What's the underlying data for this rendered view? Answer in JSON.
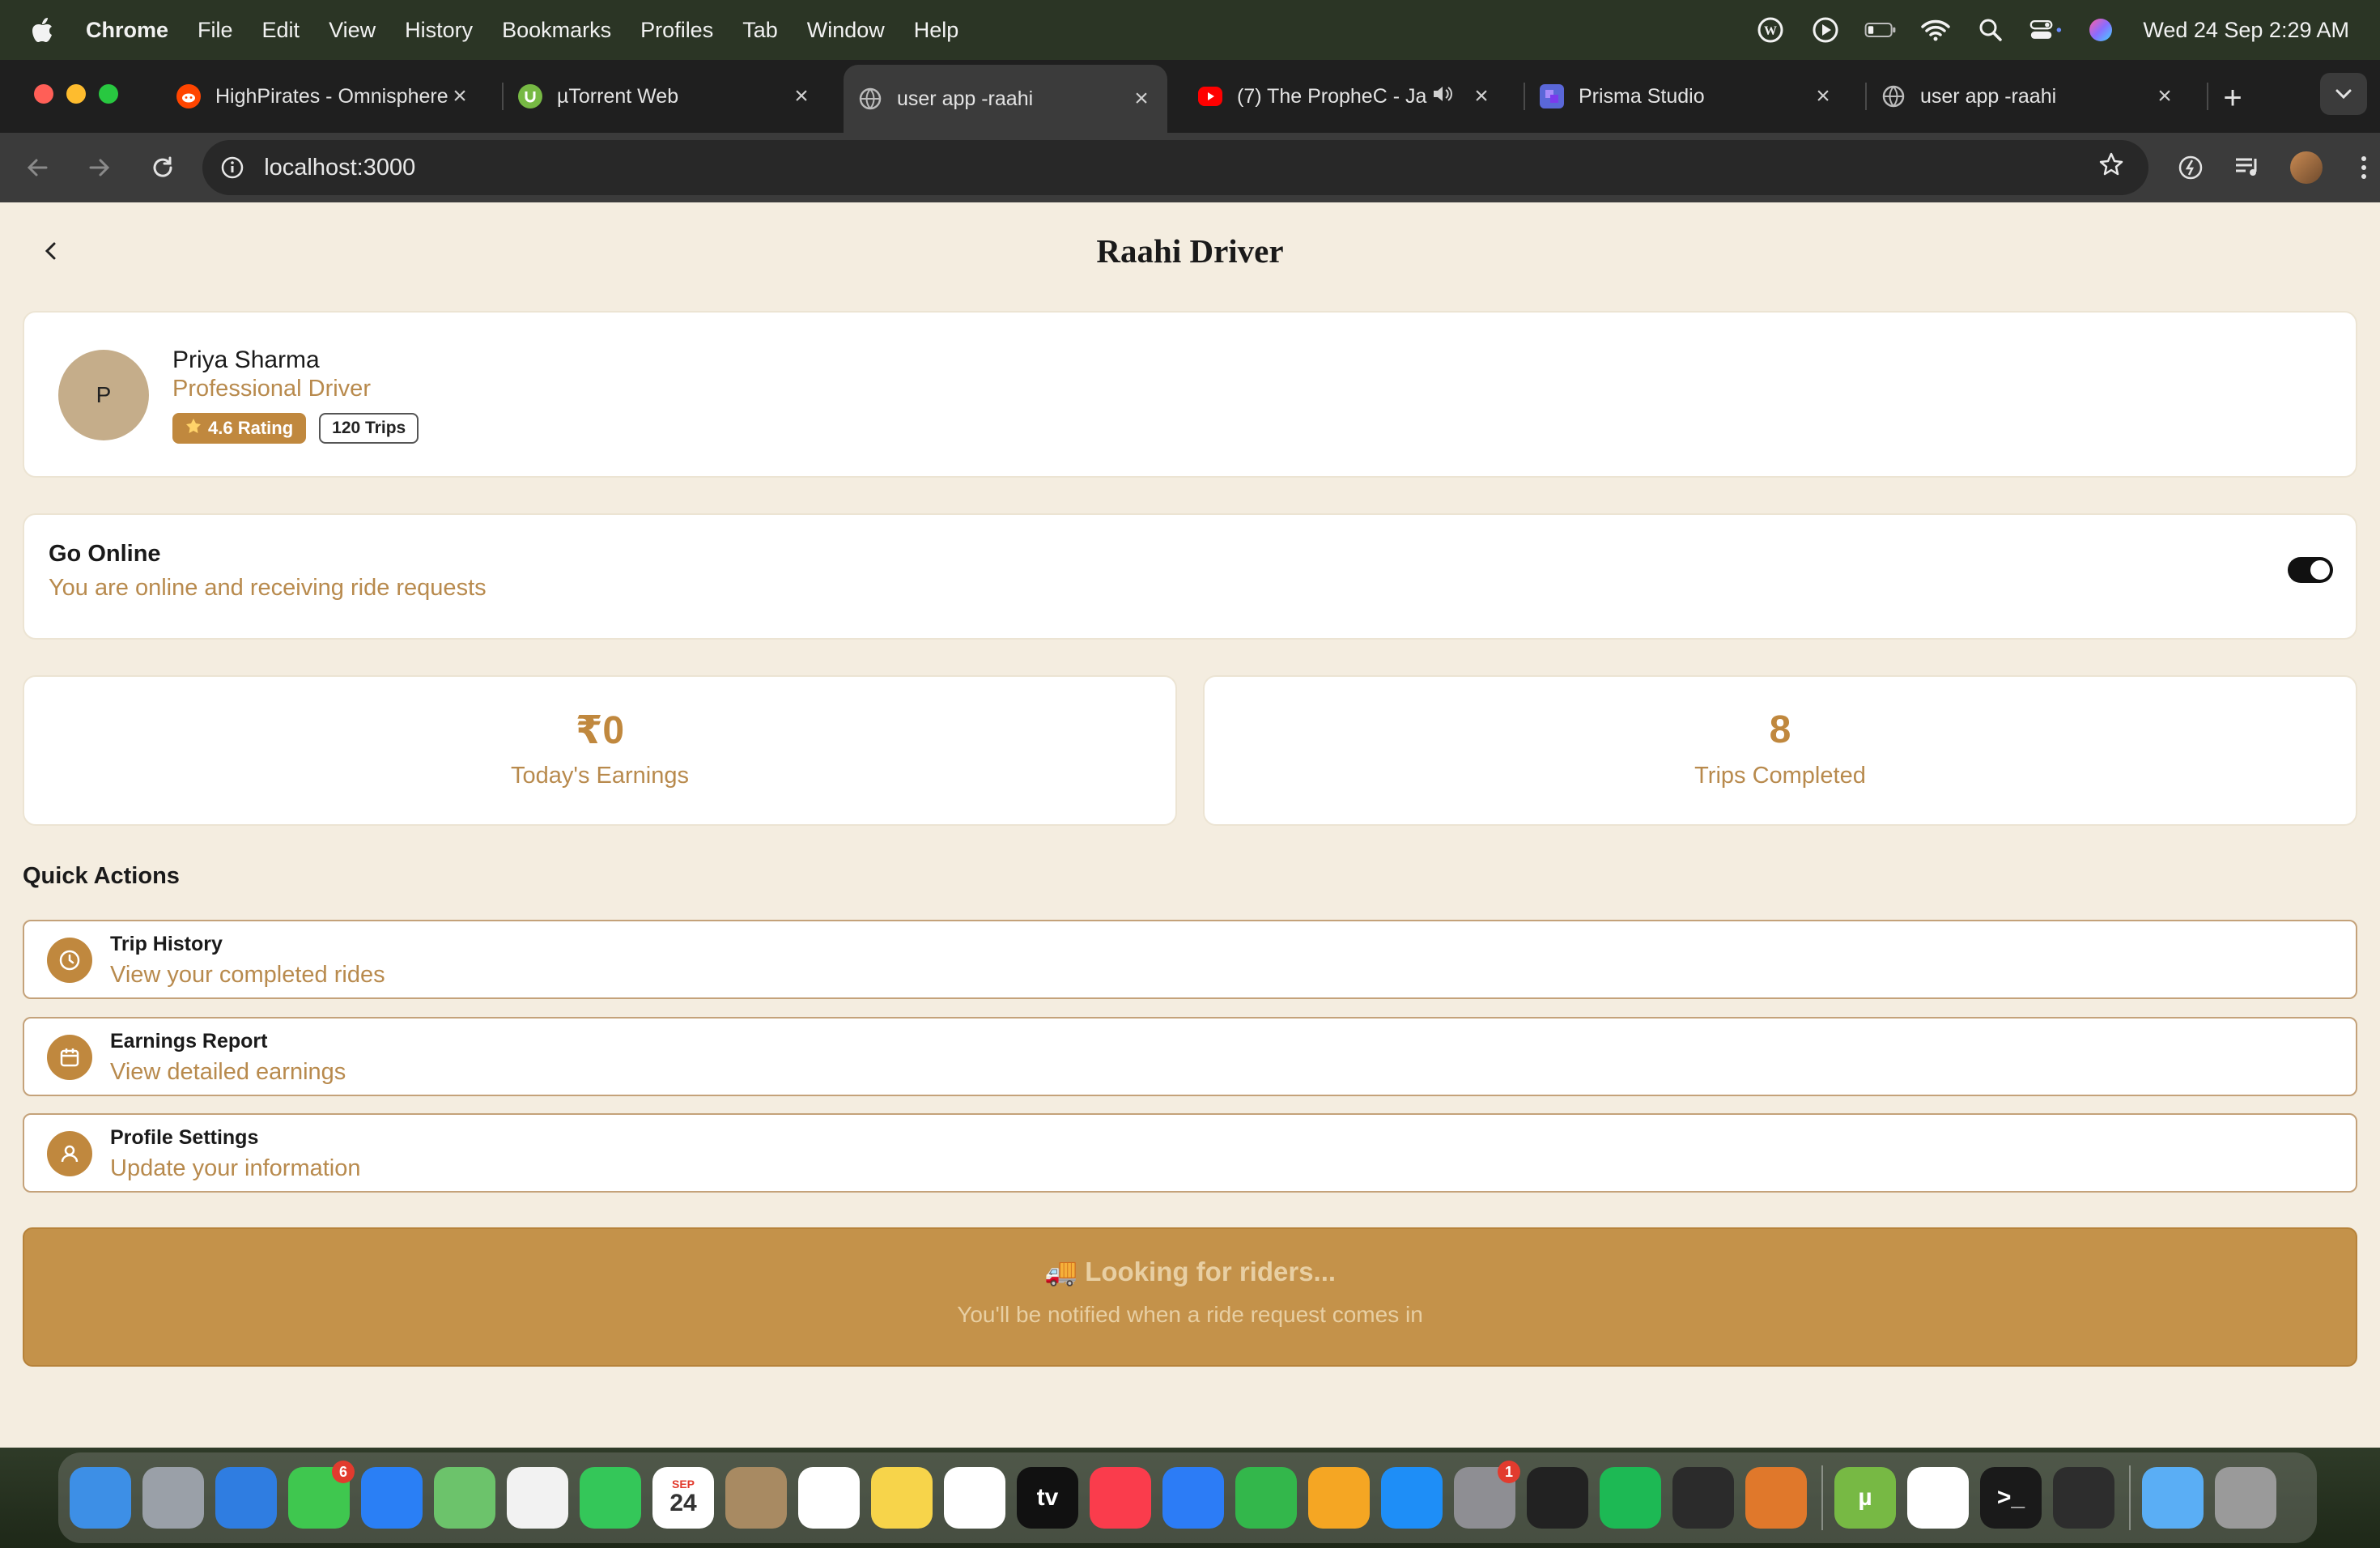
{
  "menubar": {
    "app": "Chrome",
    "items": [
      "File",
      "Edit",
      "View",
      "History",
      "Bookmarks",
      "Profiles",
      "Tab",
      "Window",
      "Help"
    ],
    "clock": "Wed 24 Sep  2:29 AM"
  },
  "tabs": [
    {
      "title": "HighPirates - Omnisphere",
      "favicon": "reddit-icon",
      "color": "#ff4500"
    },
    {
      "title": "µTorrent Web",
      "favicon": "utorrent-icon",
      "color": "#77b944"
    },
    {
      "title": "user app -raahi",
      "favicon": "globe-icon",
      "color": "#aaaaaa",
      "active": true
    },
    {
      "title": "(7) The PropheC - Ja",
      "favicon": "youtube-icon",
      "color": "#ff0000",
      "audio": true
    },
    {
      "title": "Prisma Studio",
      "favicon": "prisma-icon",
      "color": "#5a67d8"
    },
    {
      "title": "user app -raahi",
      "favicon": "globe-icon",
      "color": "#aaaaaa"
    }
  ],
  "toolbar": {
    "url": "localhost:3000"
  },
  "page": {
    "title": "Raahi Driver",
    "profile": {
      "initial": "P",
      "name": "Priya Sharma",
      "role": "Professional Driver",
      "rating": "4.6 Rating",
      "trips": "120 Trips"
    },
    "online": {
      "title": "Go Online",
      "subtitle": "You are online and receiving ride requests",
      "on": true
    },
    "stats": {
      "earnings_value": "₹0",
      "earnings_label": "Today's Earnings",
      "trips_value": "8",
      "trips_label": "Trips Completed"
    },
    "quick_actions_title": "Quick Actions",
    "actions": [
      {
        "title": "Trip History",
        "subtitle": "View your completed rides",
        "icon": "clock-icon"
      },
      {
        "title": "Earnings Report",
        "subtitle": "View detailed earnings",
        "icon": "calendar-icon"
      },
      {
        "title": "Profile Settings",
        "subtitle": "Update your information",
        "icon": "user-icon"
      }
    ],
    "banner": {
      "title": "🚚 Looking for riders...",
      "subtitle": "You'll be notified when a ride request comes in"
    }
  },
  "dock": {
    "apps": [
      {
        "name": "finder",
        "color": "#3d8fe6",
        "glyph": ""
      },
      {
        "name": "launchpad",
        "color": "#9aa0a8",
        "glyph": ""
      },
      {
        "name": "safari",
        "color": "#2f7de1",
        "glyph": ""
      },
      {
        "name": "messages",
        "color": "#3fc74f",
        "glyph": "",
        "badge": "6"
      },
      {
        "name": "mail",
        "color": "#2a7ff5",
        "glyph": ""
      },
      {
        "name": "maps",
        "color": "#6cc36b",
        "glyph": ""
      },
      {
        "name": "photos",
        "color": "#f2f2f2",
        "glyph": ""
      },
      {
        "name": "facetime",
        "color": "#34c759",
        "glyph": ""
      },
      {
        "name": "calendar",
        "color": "#ffffff",
        "glyph": "24",
        "sublabel": "SEP"
      },
      {
        "name": "contacts",
        "color": "#a88a62",
        "glyph": ""
      },
      {
        "name": "reminders",
        "color": "#ffffff",
        "glyph": ""
      },
      {
        "name": "notes",
        "color": "#f7d44a",
        "glyph": ""
      },
      {
        "name": "freeform",
        "color": "#ffffff",
        "glyph": ""
      },
      {
        "name": "apple-tv",
        "color": "#111111",
        "glyph": "tv"
      },
      {
        "name": "music",
        "color": "#fa3c4c",
        "glyph": ""
      },
      {
        "name": "keynote",
        "color": "#2c7cf6",
        "glyph": ""
      },
      {
        "name": "numbers",
        "color": "#33b74b",
        "glyph": ""
      },
      {
        "name": "pages",
        "color": "#f5a623",
        "glyph": ""
      },
      {
        "name": "app-store",
        "color": "#1e8ef7",
        "glyph": ""
      },
      {
        "name": "system-settings",
        "color": "#8e8e93",
        "glyph": "",
        "badge": "1"
      },
      {
        "name": "logic-pro",
        "color": "#222222",
        "glyph": ""
      },
      {
        "name": "spotify",
        "color": "#1db954",
        "glyph": ""
      },
      {
        "name": "instruments",
        "color": "#2b2b2b",
        "glyph": ""
      },
      {
        "name": "fl-studio",
        "color": "#e0782b",
        "glyph": ""
      }
    ],
    "recent": [
      {
        "name": "utorrent",
        "color": "#77b944",
        "glyph": "µ"
      },
      {
        "name": "chrome",
        "color": "#ffffff",
        "glyph": ""
      },
      {
        "name": "terminal",
        "color": "#1a1a1a",
        "glyph": ">_"
      },
      {
        "name": "cursor",
        "color": "#2d2d2d",
        "glyph": ""
      }
    ],
    "tail": [
      {
        "name": "downloads-folder",
        "color": "#5aaef5",
        "glyph": ""
      },
      {
        "name": "trash",
        "color": "#9a9a9a",
        "glyph": ""
      }
    ]
  }
}
